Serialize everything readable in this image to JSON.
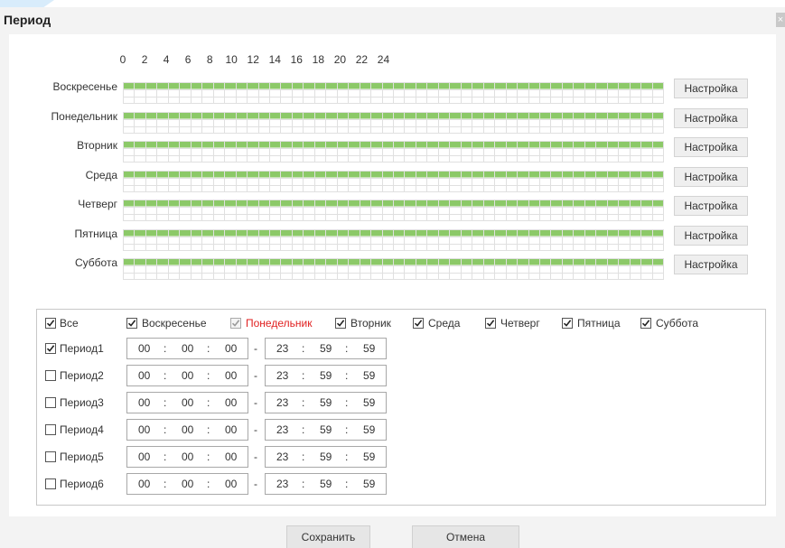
{
  "dialog": {
    "title": "Период",
    "close_icon": "close-icon"
  },
  "hour_ticks": [
    "0",
    "2",
    "4",
    "6",
    "8",
    "10",
    "12",
    "14",
    "16",
    "18",
    "20",
    "22",
    "24"
  ],
  "days": [
    {
      "label": "Воскресенье",
      "button": "Настройка",
      "active_from_hour": 0,
      "active_to_hour": 24
    },
    {
      "label": "Понедельник",
      "button": "Настройка",
      "active_from_hour": 0,
      "active_to_hour": 24
    },
    {
      "label": "Вторник",
      "button": "Настройка",
      "active_from_hour": 0,
      "active_to_hour": 24
    },
    {
      "label": "Среда",
      "button": "Настройка",
      "active_from_hour": 0,
      "active_to_hour": 24
    },
    {
      "label": "Четверг",
      "button": "Настройка",
      "active_from_hour": 0,
      "active_to_hour": 24
    },
    {
      "label": "Пятница",
      "button": "Настройка",
      "active_from_hour": 0,
      "active_to_hour": 24
    },
    {
      "label": "Суббота",
      "button": "Настройка",
      "active_from_hour": 0,
      "active_to_hour": 24
    }
  ],
  "day_select": {
    "all": {
      "label": "Все",
      "checked": true
    },
    "days": [
      {
        "label": "Воскресенье",
        "checked": true,
        "current": false
      },
      {
        "label": "Понедельник",
        "checked": true,
        "current": true
      },
      {
        "label": "Вторник",
        "checked": true,
        "current": false
      },
      {
        "label": "Среда",
        "checked": true,
        "current": false
      },
      {
        "label": "Четверг",
        "checked": true,
        "current": false
      },
      {
        "label": "Пятница",
        "checked": true,
        "current": false
      },
      {
        "label": "Суббота",
        "checked": true,
        "current": false
      }
    ]
  },
  "periods": [
    {
      "label": "Период1",
      "checked": true,
      "start": [
        "00",
        "00",
        "00"
      ],
      "end": [
        "23",
        "59",
        "59"
      ]
    },
    {
      "label": "Период2",
      "checked": false,
      "start": [
        "00",
        "00",
        "00"
      ],
      "end": [
        "23",
        "59",
        "59"
      ]
    },
    {
      "label": "Период3",
      "checked": false,
      "start": [
        "00",
        "00",
        "00"
      ],
      "end": [
        "23",
        "59",
        "59"
      ]
    },
    {
      "label": "Период4",
      "checked": false,
      "start": [
        "00",
        "00",
        "00"
      ],
      "end": [
        "23",
        "59",
        "59"
      ]
    },
    {
      "label": "Период5",
      "checked": false,
      "start": [
        "00",
        "00",
        "00"
      ],
      "end": [
        "23",
        "59",
        "59"
      ]
    },
    {
      "label": "Период6",
      "checked": false,
      "start": [
        "00",
        "00",
        "00"
      ],
      "end": [
        "23",
        "59",
        "59"
      ]
    }
  ],
  "time_separator": ":",
  "range_separator": "-",
  "footer": {
    "save_label": "Сохранить",
    "cancel_label": "Отмена"
  },
  "colors": {
    "active_slot": "#8cc968",
    "current_day_text": "#e01f1f",
    "dialog_bg": "#f3f3f3"
  }
}
